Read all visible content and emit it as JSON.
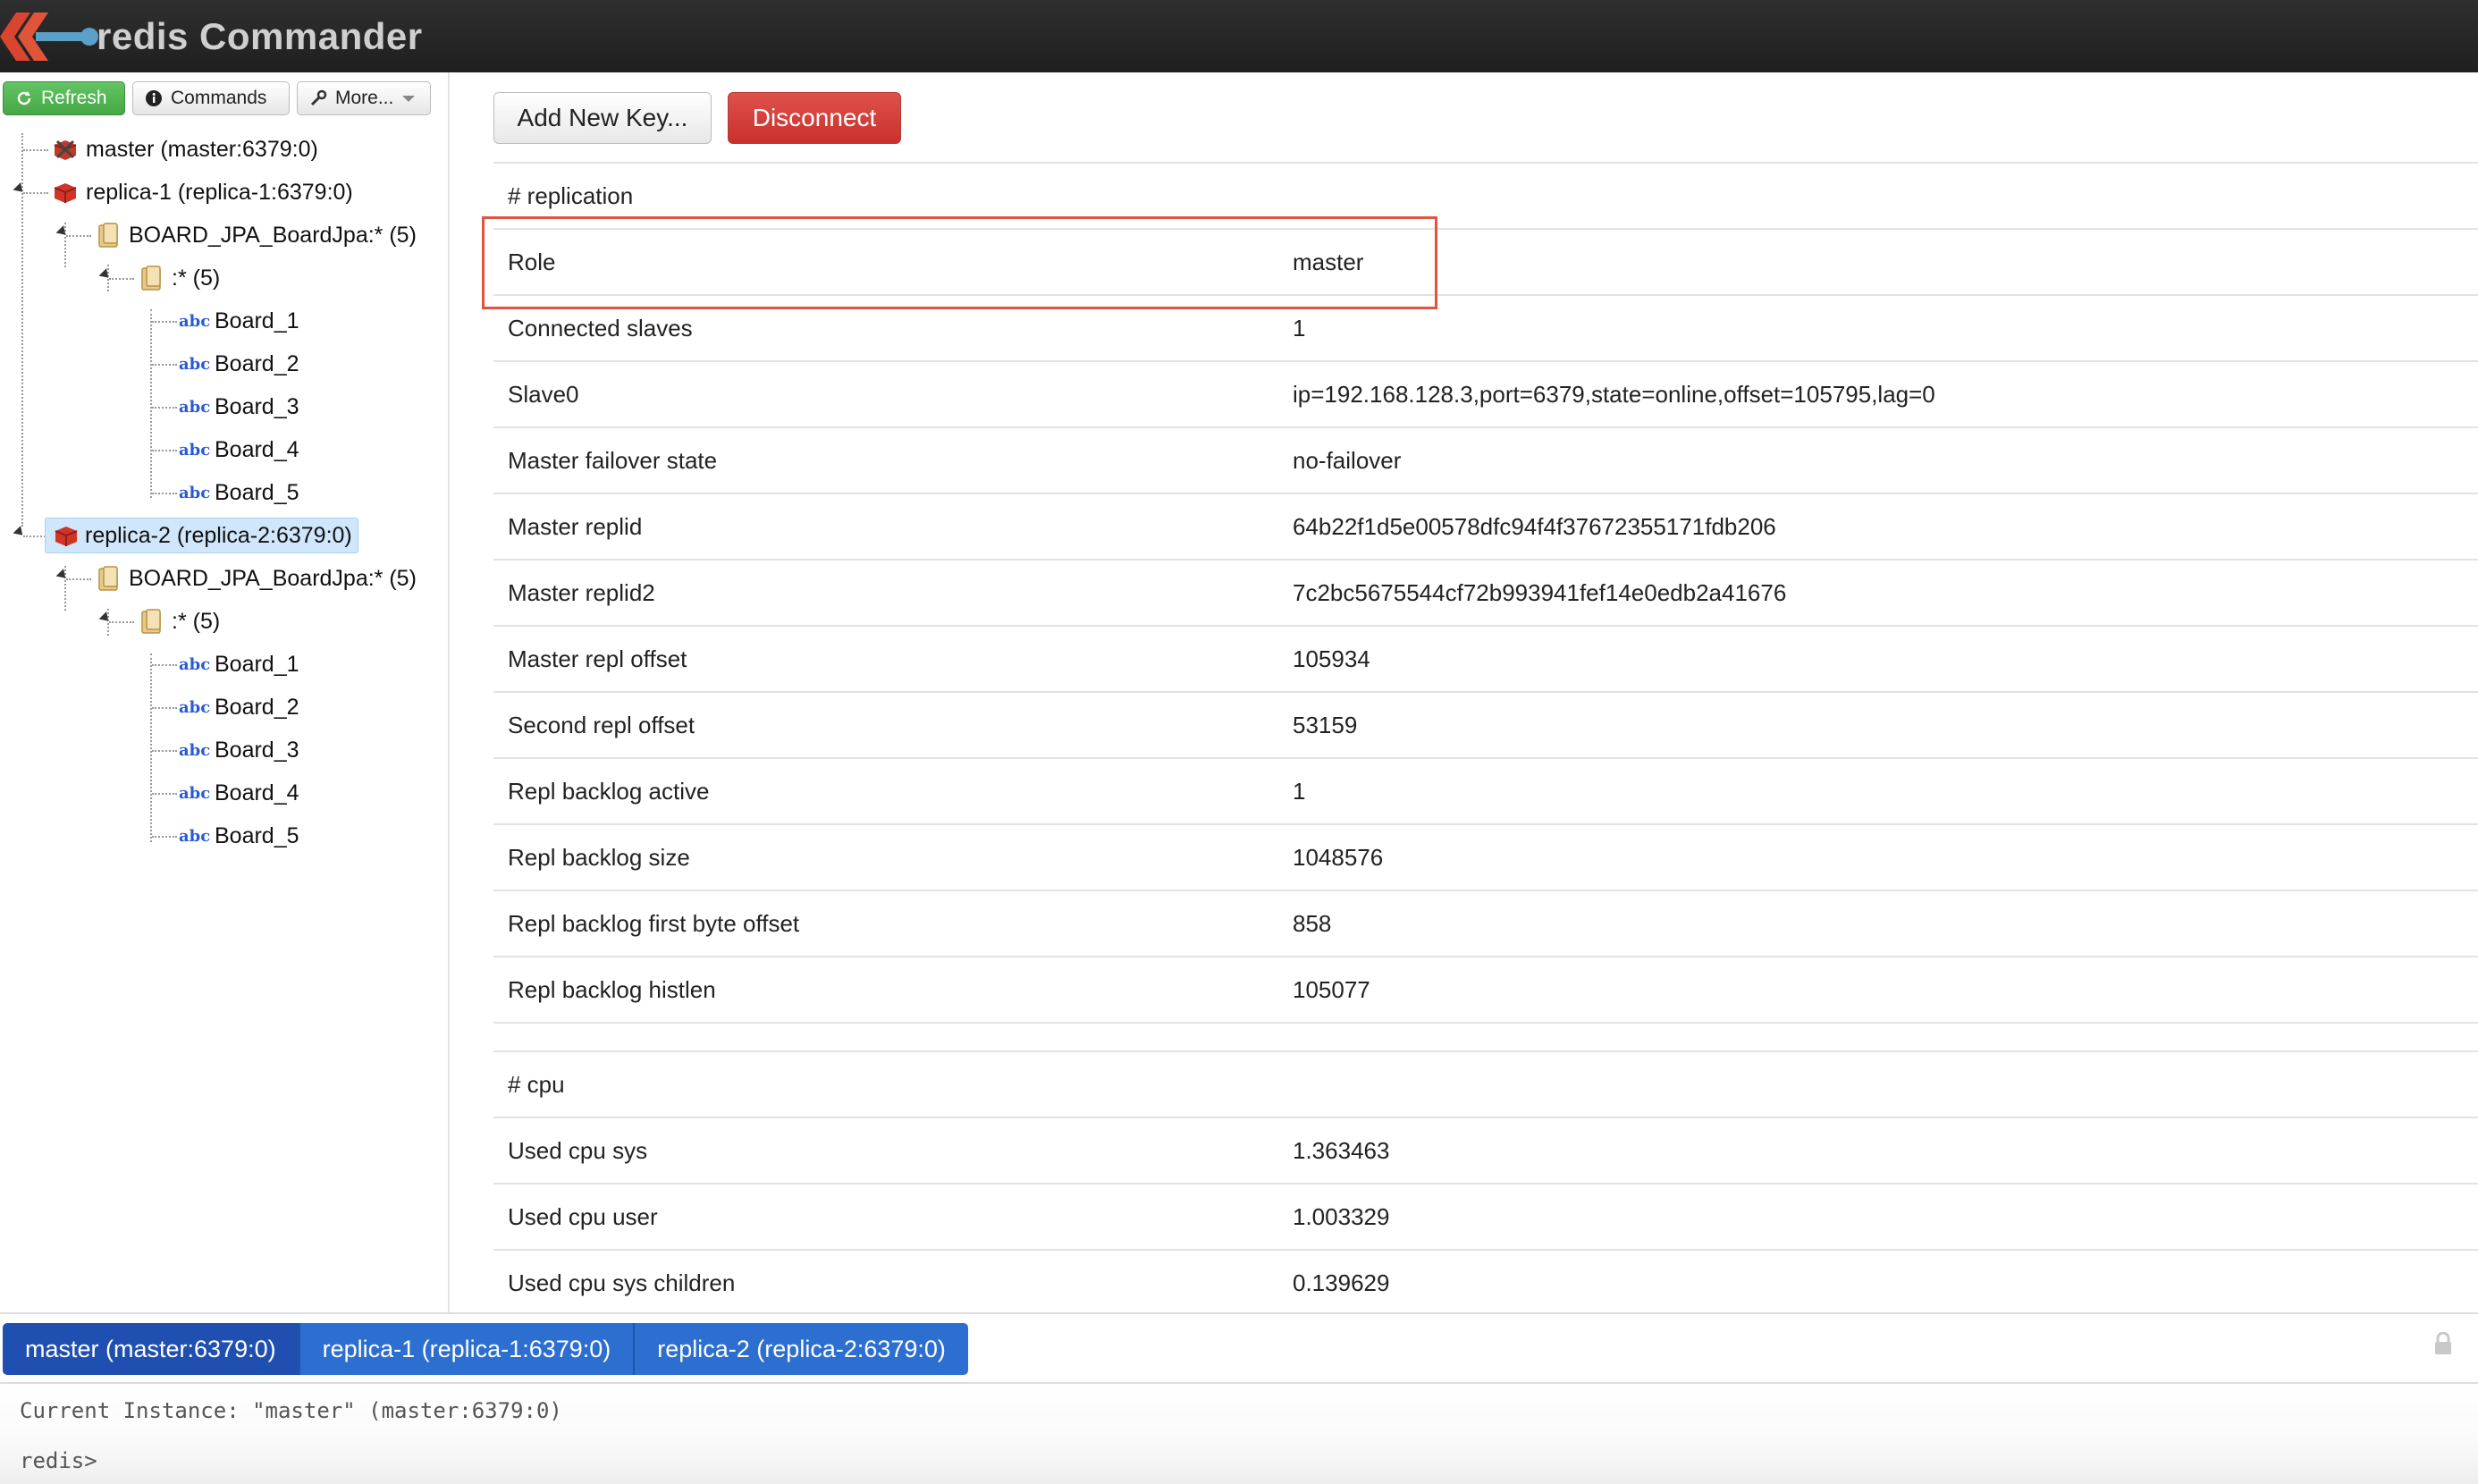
{
  "app": {
    "title": "redis Commander"
  },
  "toolbar": {
    "refresh": "Refresh",
    "commands": "Commands",
    "more": "More..."
  },
  "tree": {
    "master": "master (master:6379:0)",
    "replica1": {
      "label": "replica-1 (replica-1:6379:0)",
      "folder": "BOARD_JPA_BoardJpa:* (5)",
      "subfolder": ":* (5)",
      "keys": [
        "Board_1",
        "Board_2",
        "Board_3",
        "Board_4",
        "Board_5"
      ]
    },
    "replica2": {
      "label": "replica-2 (replica-2:6379:0)",
      "folder": "BOARD_JPA_BoardJpa:* (5)",
      "subfolder": ":* (5)",
      "keys": [
        "Board_1",
        "Board_2",
        "Board_3",
        "Board_4",
        "Board_5"
      ]
    },
    "key_type_icon": "abc"
  },
  "actions": {
    "add_key": "Add New Key...",
    "disconnect": "Disconnect"
  },
  "info": {
    "replication_header": "# replication",
    "replication": [
      {
        "key": "Role",
        "value": "master"
      },
      {
        "key": "Connected slaves",
        "value": "1"
      },
      {
        "key": "Slave0",
        "value": "ip=192.168.128.3,port=6379,state=online,offset=105795,lag=0"
      },
      {
        "key": "Master failover state",
        "value": "no-failover"
      },
      {
        "key": "Master replid",
        "value": "64b22f1d5e00578dfc94f4f37672355171fdb206"
      },
      {
        "key": "Master replid2",
        "value": "7c2bc5675544cf72b993941fef14e0edb2a41676"
      },
      {
        "key": "Master repl offset",
        "value": "105934"
      },
      {
        "key": "Second repl offset",
        "value": "53159"
      },
      {
        "key": "Repl backlog active",
        "value": "1"
      },
      {
        "key": "Repl backlog size",
        "value": "1048576"
      },
      {
        "key": "Repl backlog first byte offset",
        "value": "858"
      },
      {
        "key": "Repl backlog histlen",
        "value": "105077"
      }
    ],
    "cpu_header": "# cpu",
    "cpu": [
      {
        "key": "Used cpu sys",
        "value": "1.363463"
      },
      {
        "key": "Used cpu user",
        "value": "1.003329"
      },
      {
        "key": "Used cpu sys children",
        "value": "0.139629"
      }
    ]
  },
  "tabs": [
    "master (master:6379:0)",
    "replica-1 (replica-1:6379:0)",
    "replica-2 (replica-2:6379:0)"
  ],
  "console": {
    "current_instance": "Current Instance: \"master\" (master:6379:0)",
    "prompt": "redis>"
  },
  "colors": {
    "header_bg": "#262626",
    "refresh_green": "#4cae4c",
    "disconnect_red": "#d9534f",
    "tab_blue": "#2d6fd0",
    "highlight_border": "#e2533f",
    "abc_blue": "#2a5bd7"
  }
}
